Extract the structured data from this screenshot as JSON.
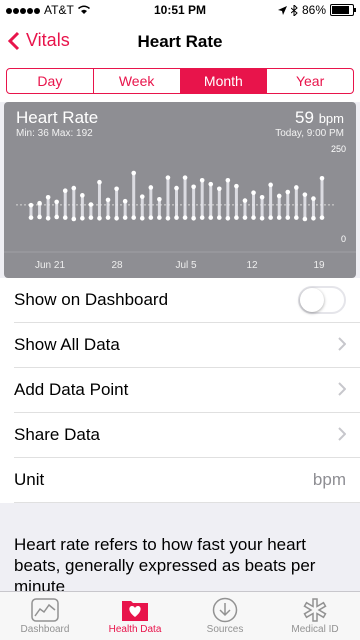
{
  "status": {
    "carrier": "AT&T",
    "time": "10:51 PM",
    "battery": "86%"
  },
  "nav": {
    "back_label": "Vitals",
    "title": "Heart Rate"
  },
  "segments": [
    {
      "label": "Day"
    },
    {
      "label": "Week"
    },
    {
      "label": "Month",
      "active": true
    },
    {
      "label": "Year"
    }
  ],
  "chart_header": {
    "title": "Heart Rate",
    "minmax": "Min: 36  Max: 192",
    "value": "59",
    "unit": "bpm",
    "time": "Today, 9:00 PM"
  },
  "chart_data": {
    "type": "range-bar",
    "ylim": [
      0,
      250
    ],
    "y_tick_labels": [
      "250",
      "0"
    ],
    "x_tick_labels": [
      "Jun 21",
      "28",
      "Jul 5",
      "12",
      "19"
    ],
    "ranges": [
      [
        56,
        94
      ],
      [
        58,
        100
      ],
      [
        54,
        118
      ],
      [
        58,
        104
      ],
      [
        56,
        138
      ],
      [
        52,
        146
      ],
      [
        54,
        124
      ],
      [
        56,
        96
      ],
      [
        54,
        164
      ],
      [
        56,
        110
      ],
      [
        54,
        144
      ],
      [
        56,
        106
      ],
      [
        56,
        192
      ],
      [
        54,
        120
      ],
      [
        56,
        148
      ],
      [
        56,
        112
      ],
      [
        54,
        178
      ],
      [
        56,
        146
      ],
      [
        56,
        178
      ],
      [
        54,
        150
      ],
      [
        56,
        170
      ],
      [
        56,
        158
      ],
      [
        56,
        144
      ],
      [
        54,
        170
      ],
      [
        56,
        152
      ],
      [
        56,
        108
      ],
      [
        56,
        132
      ],
      [
        54,
        118
      ],
      [
        56,
        156
      ],
      [
        56,
        122
      ],
      [
        56,
        134
      ],
      [
        56,
        148
      ],
      [
        52,
        126
      ],
      [
        54,
        114
      ],
      [
        56,
        176
      ]
    ],
    "mean_line": 95
  },
  "list": {
    "show_on_dashboard": "Show on Dashboard",
    "show_all_data": "Show All Data",
    "add_data_point": "Add Data Point",
    "share_data": "Share Data",
    "unit_label": "Unit",
    "unit_value": "bpm"
  },
  "description": "Heart rate refers to how fast your heart beats, generally expressed as beats per minute",
  "tabs": [
    {
      "label": "Dashboard"
    },
    {
      "label": "Health Data",
      "active": true
    },
    {
      "label": "Sources"
    },
    {
      "label": "Medical ID"
    }
  ],
  "colors": {
    "accent": "#e8144b",
    "chart_bg": "#8e8e93"
  }
}
